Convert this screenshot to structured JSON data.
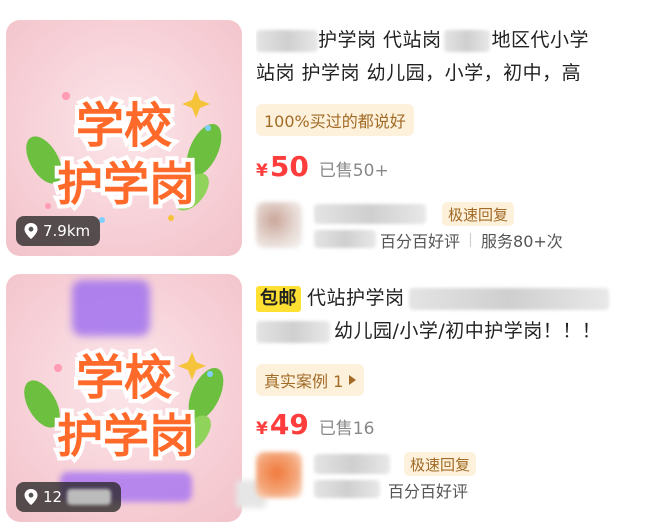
{
  "listings": [
    {
      "title_line1_visible": "护学岗 代站岗",
      "title_line1_tail": "地区代小学",
      "title_line2": "站岗 护学岗  幼儿园，小学，初中，高",
      "tag": "100%买过的都说好",
      "price_symbol": "¥",
      "price": "50",
      "sold": "已售50+",
      "speed_badge": "极速回复",
      "meta": [
        "百分百好评",
        "服务80+次"
      ],
      "distance": "7.9km",
      "sticker_line1": "学校",
      "sticker_line2": "护学岗"
    },
    {
      "free_shipping": "包邮",
      "title_line1_visible": "代站护学岗",
      "title_line2_tail": "幼儿园/小学/初中护学岗！！！",
      "tag": "真实案例 1",
      "price_symbol": "¥",
      "price": "49",
      "sold": "已售16",
      "speed_badge": "极速回复",
      "meta": [
        "百分百好评"
      ],
      "distance": "12",
      "sticker_line1": "学校",
      "sticker_line2": "护学岗"
    }
  ],
  "colors": {
    "price": "#ff3d3d",
    "tag_bg": "#fdf1dc",
    "tag_text": "#a26b26",
    "free_shipping_bg": "#ffe033"
  },
  "icons": [
    "location-pin-icon",
    "play-triangle-icon"
  ]
}
